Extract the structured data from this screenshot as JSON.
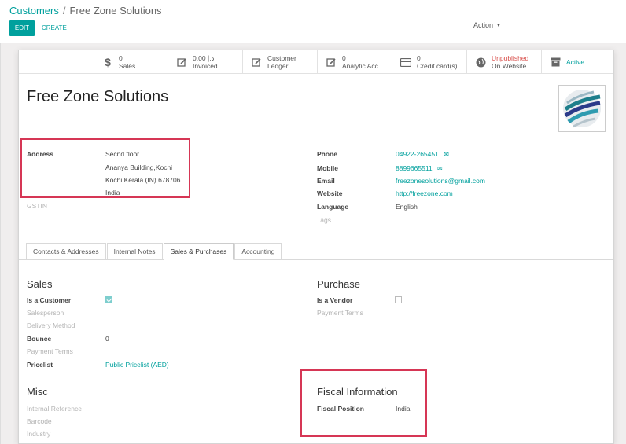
{
  "breadcrumb": {
    "parent": "Customers",
    "separator": "/",
    "current": "Free Zone Solutions"
  },
  "toolbar": {
    "edit_label": "EDIT",
    "create_label": "CREATE",
    "action_label": "Action"
  },
  "stat_buttons": {
    "sales": {
      "value": "0",
      "label": "Sales",
      "icon": "dollar-icon"
    },
    "invoiced": {
      "value": "0.00 د.إ",
      "label": "Invoiced",
      "icon": "pencil-square-icon"
    },
    "ledger": {
      "line1": "Customer",
      "line2": "Ledger",
      "icon": "edit-icon"
    },
    "analytic": {
      "value": "0",
      "label": "Analytic Acc...",
      "icon": "pencil-square-icon"
    },
    "credit": {
      "value": "0",
      "label": "Credit card(s)",
      "icon": "credit-card-icon"
    },
    "website": {
      "line1": "Unpublished",
      "line2": "On Website",
      "icon": "globe-icon"
    },
    "active": {
      "label": "Active",
      "icon": "archive-icon"
    }
  },
  "partner": {
    "name": "Free Zone Solutions"
  },
  "address": {
    "label": "Address",
    "line1": "Secnd floor",
    "line2": "Ananya Building,Kochi",
    "line3": "Kochi  Kerala (IN)  678706",
    "line4": "India"
  },
  "gstin_label": "GSTIN",
  "contact": {
    "phone_label": "Phone",
    "phone": "04922-265451",
    "mobile_label": "Mobile",
    "mobile": "8899665511",
    "email_label": "Email",
    "email": "freezonesolutions@gmail.com",
    "website_label": "Website",
    "website": "http://freezone.com",
    "language_label": "Language",
    "language": "English",
    "tags_placeholder": "Tags"
  },
  "tabs": [
    "Contacts & Addresses",
    "Internal Notes",
    "Sales & Purchases",
    "Accounting"
  ],
  "sales": {
    "title": "Sales",
    "is_customer_label": "Is a Customer",
    "salesperson_label": "Salesperson",
    "delivery_label": "Delivery Method",
    "bounce_label": "Bounce",
    "bounce_value": "0",
    "payment_terms_label": "Payment Terms",
    "pricelist_label": "Pricelist",
    "pricelist_value": "Public Pricelist (AED)"
  },
  "purchase": {
    "title": "Purchase",
    "is_vendor_label": "Is a Vendor",
    "payment_terms_label": "Payment Terms"
  },
  "misc": {
    "title": "Misc",
    "internal_ref_label": "Internal Reference",
    "barcode_label": "Barcode",
    "industry_label": "Industry"
  },
  "fiscal": {
    "title": "Fiscal Information",
    "position_label": "Fiscal Position",
    "position_value": "India"
  },
  "colors": {
    "accent": "#00a09d",
    "highlight": "#d63655",
    "unpublished": "#d9534f"
  }
}
